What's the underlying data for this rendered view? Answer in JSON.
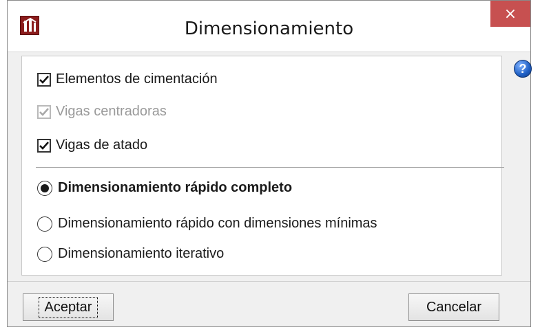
{
  "window": {
    "title": "Dimensionamiento",
    "close_label": "×"
  },
  "checkboxes": [
    {
      "label": "Elementos de cimentación",
      "checked": true,
      "enabled": true
    },
    {
      "label": "Vigas centradoras",
      "checked": true,
      "enabled": false
    },
    {
      "label": "Vigas de atado",
      "checked": true,
      "enabled": true
    }
  ],
  "radios": [
    {
      "label": "Dimensionamiento rápido completo",
      "selected": true
    },
    {
      "label": "Dimensionamiento rápido con dimensiones mínimas",
      "selected": false
    },
    {
      "label": "Dimensionamiento iterativo",
      "selected": false
    }
  ],
  "help": {
    "label": "?"
  },
  "buttons": {
    "accept": "Aceptar",
    "cancel": "Cancelar"
  },
  "colors": {
    "close_button": "#c75050",
    "app_icon": "#8b1d1d",
    "help_icon": "#1f5fc4"
  },
  "icons": {
    "app": "app-logo-icon",
    "close": "close-icon",
    "help": "help-icon"
  }
}
